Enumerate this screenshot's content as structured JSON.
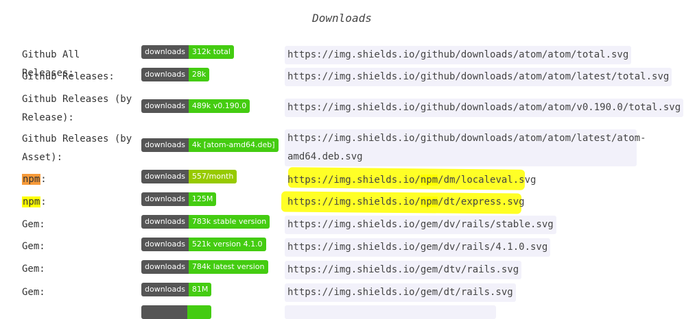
{
  "heading": "Downloads",
  "colors": {
    "badge_label_bg": "#555555",
    "green": "#4c1",
    "yellowgreen": "#a4a61d",
    "highlight": "#ffff00",
    "highlight_orange": "#f79a3a"
  },
  "rows": [
    {
      "label": "Github All Releases:",
      "badge_label": "downloads",
      "badge_value": "312k total",
      "badge_color": "#4c1",
      "url": "https://img.shields.io/github/downloads/atom/atom/total.svg"
    },
    {
      "label": "Github Releases:",
      "badge_label": "downloads",
      "badge_value": "28k",
      "badge_color": "#4c1",
      "url": "https://img.shields.io/github/downloads/atom/atom/latest/total.svg"
    },
    {
      "label": "Github Releases (by Release):",
      "badge_label": "downloads",
      "badge_value": "489k v0.190.0",
      "badge_color": "#4c1",
      "url": "https://img.shields.io/github/downloads/atom/atom/v0.190.0/total.svg"
    },
    {
      "label": "Github Releases (by Asset):",
      "badge_label": "downloads",
      "badge_value": "4k [atom-amd64.deb]",
      "badge_color": "#4c1",
      "url": "https://img.shields.io/github/downloads/atom/atom/latest/atom-amd64.deb.svg"
    },
    {
      "label_prefix": "npm",
      "label_suffix": ":",
      "badge_label": "downloads",
      "badge_value": "557/month",
      "badge_color": "#97ca00",
      "url_a": "https://img.shields.io/",
      "url_b": "npm",
      "url_c": "/dm/localeval.svg"
    },
    {
      "label_prefix": "npm",
      "label_suffix": ":",
      "badge_label": "downloads",
      "badge_value": "125M",
      "badge_color": "#4c1",
      "url_a": "https://img.shields.io/",
      "url_b": "npm",
      "url_c": "/dt/express.svg"
    },
    {
      "label": "Gem:",
      "badge_label": "downloads",
      "badge_value": "783k stable version",
      "badge_color": "#4c1",
      "url": "https://img.shields.io/gem/dv/rails/stable.svg"
    },
    {
      "label": "Gem:",
      "badge_label": "downloads",
      "badge_value": "521k version 4.1.0",
      "badge_color": "#4c1",
      "url": "https://img.shields.io/gem/dv/rails/4.1.0.svg"
    },
    {
      "label": "Gem:",
      "badge_label": "downloads",
      "badge_value": "784k latest version",
      "badge_color": "#4c1",
      "url": "https://img.shields.io/gem/dtv/rails.svg"
    },
    {
      "label": "Gem:",
      "badge_label": "downloads",
      "badge_value": "81M",
      "badge_color": "#4c1",
      "url": "https://img.shields.io/gem/dt/rails.svg"
    }
  ]
}
